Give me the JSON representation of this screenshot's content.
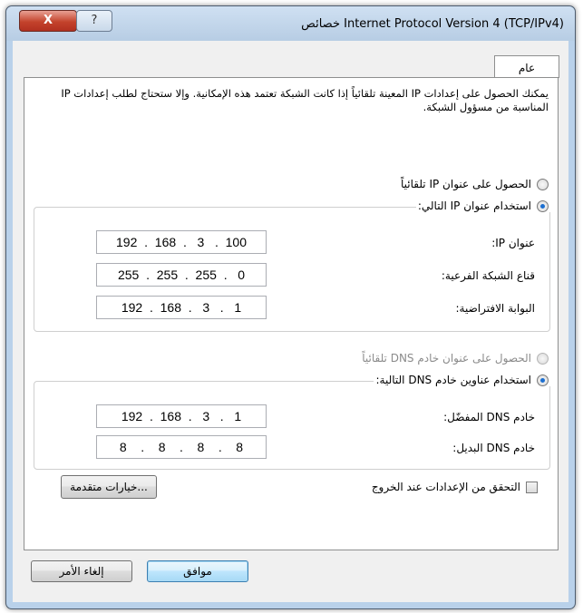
{
  "window": {
    "title": "خصائص Internet Protocol Version 4 (TCP/IPv4)",
    "close_glyph": "X",
    "help_glyph": "?"
  },
  "tabs": [
    {
      "label": "عام"
    }
  ],
  "general": {
    "description": "يمكنك الحصول على إعدادات IP المعينة تلقائياً إذا كانت الشبكة تعتمد هذه الإمكانية. وإلا ستحتاج لطلب إعدادات IP المناسبة من مسؤول الشبكة.",
    "ip_auto_label": "الحصول على عنوان IP تلقائياً",
    "ip_manual_label": "استخدام عنوان IP التالي:",
    "ip_mode": "manual",
    "ip_fields": [
      {
        "label": "عنوان IP:",
        "value": "192  .  168  .   3   .  100"
      },
      {
        "label": "قناع الشبكة الفرعية:",
        "value": "255  .  255  .  255  .   0"
      },
      {
        "label": "البوابة الافتراضية:",
        "value": "192  .  168  .   3   .   1"
      }
    ],
    "dns_auto_label": "الحصول على عنوان خادم DNS تلقائياً",
    "dns_manual_label": "استخدام عناوين خادم DNS التالية:",
    "dns_mode": "manual",
    "dns_fields": [
      {
        "label": "خادم DNS المفضّل:",
        "value": "192  .  168  .   3   .   1"
      },
      {
        "label": "خادم DNS البديل:",
        "value": "8    .    8    .    8    .    8"
      }
    ],
    "validate_label": "التحقق من الإعدادات عند الخروج",
    "validate_checked": false,
    "advanced_label": "خيارات متقدمة..."
  },
  "buttons": {
    "ok_label": "موافق",
    "cancel_label": "إلغاء الأمر"
  }
}
